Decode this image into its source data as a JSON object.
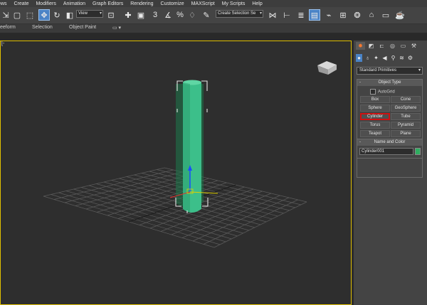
{
  "menu": [
    "ews",
    "Create",
    "Modifiers",
    "Animation",
    "Graph Editors",
    "Rendering",
    "Customize",
    "MAXScript",
    "My Scripts",
    "Help"
  ],
  "toolbar": {
    "view_dropdown": "View",
    "selection_set": "Create Selection Se",
    "snap_label": "3"
  },
  "ribbon": {
    "tab1": "eeform",
    "tab2": "Selection",
    "tab3": "Object Paint"
  },
  "viewport": {
    "label": "[-",
    "object_color": "#3cbf8a",
    "grid_color": "#5c5c5c"
  },
  "command_panel": {
    "primitive_type": "Standard Primitives",
    "object_type": {
      "title": "Object Type",
      "autogrid": "AutoGrid",
      "buttons": [
        "Box",
        "Cone",
        "Sphere",
        "GeoSphere",
        "Cylinder",
        "Tube",
        "Torus",
        "Pyramid",
        "Teapot",
        "Plane"
      ],
      "selected": "Cylinder"
    },
    "name_and_color": {
      "title": "Name and Color",
      "name": "Cylinder001",
      "color": "#2eae60"
    }
  },
  "colors": {
    "accent": "#4a83c6",
    "viewport_border": "#e0c000",
    "selected_border": "#d01010"
  }
}
